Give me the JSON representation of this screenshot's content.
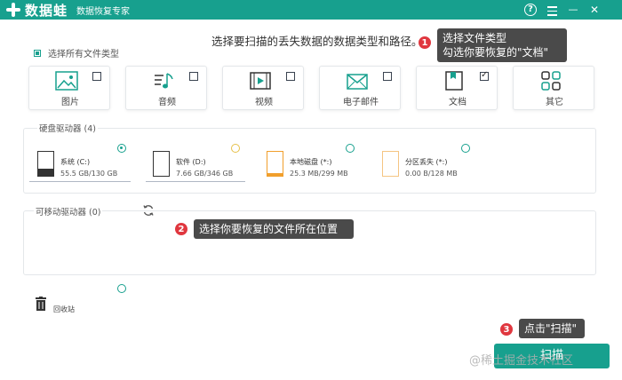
{
  "app": {
    "name": "数据蛙",
    "subtitle": "数据恢复专家",
    "help_glyph": "?",
    "min_glyph": "—",
    "close_glyph": "✕"
  },
  "header": {
    "prompt": "选择要扫描的丢失数据的数据类型和路径。",
    "select_all": "选择所有文件类型"
  },
  "file_types": [
    {
      "label": "图片",
      "icon": "image-icon",
      "checked": false
    },
    {
      "label": "音频",
      "icon": "audio-icon",
      "checked": false
    },
    {
      "label": "视频",
      "icon": "video-icon",
      "checked": false
    },
    {
      "label": "电子邮件",
      "icon": "email-icon",
      "checked": false
    },
    {
      "label": "文档",
      "icon": "document-icon",
      "checked": true
    },
    {
      "label": "其它",
      "icon": "other-icon",
      "checked": false
    }
  ],
  "disks": {
    "title": "硬盘驱动器 (4)",
    "drives": [
      {
        "name": "系统 (C:)",
        "size": "55.5 GB/130 GB",
        "selected": true
      },
      {
        "name": "软件 (D:)",
        "size": "7.66 GB/346 GB",
        "selected": false
      },
      {
        "name": "本地磁盘 (*:)",
        "size": "25.3 MB/299 MB",
        "selected": false
      },
      {
        "name": "分区丢失 (*:)",
        "size": "0.00  B/128 MB",
        "selected": false
      }
    ]
  },
  "removable": {
    "title": "可移动驱动器 (0)"
  },
  "recycle": {
    "label": "回收站"
  },
  "tips": [
    {
      "num": "1",
      "line1": "选择文件类型",
      "line2": "勾选你要恢复的\"文档\""
    },
    {
      "num": "2",
      "text": "选择你要恢复的文件所在位置"
    },
    {
      "num": "3",
      "text": "点击\"扫描\""
    }
  ],
  "scan_button": "扫描",
  "watermark": "@稀土掘金技术社区",
  "colors": {
    "accent": "#17a08e",
    "callout": "#4a4a4a",
    "badge": "#e0373f",
    "drive_orange": "#f19f2c"
  }
}
